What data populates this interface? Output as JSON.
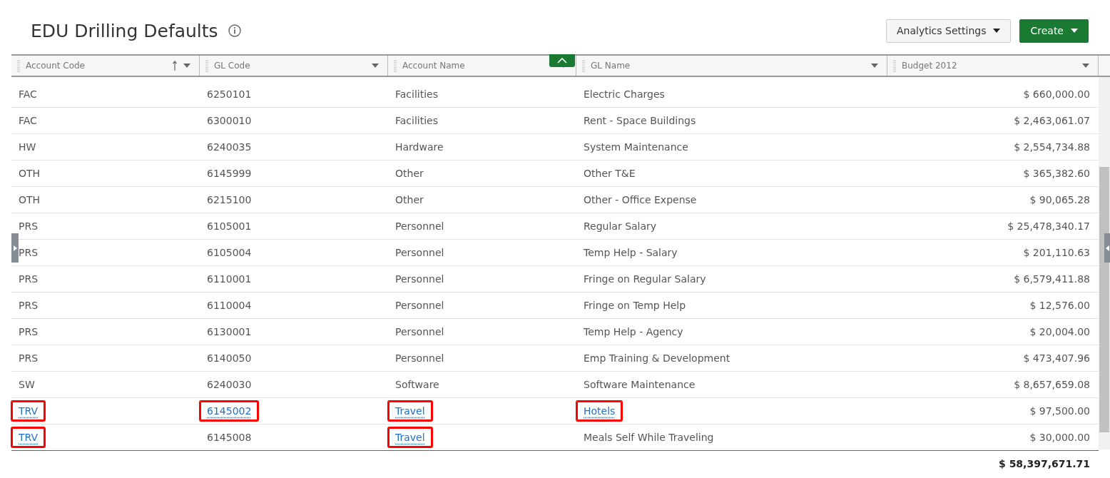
{
  "page": {
    "title": "EDU Drilling Defaults"
  },
  "toolbar": {
    "buttons": [
      {
        "label": "Analytics Settings",
        "kind": "secondary"
      },
      {
        "label": "Create",
        "kind": "primary"
      }
    ]
  },
  "table": {
    "columns": [
      {
        "label": "Account Code",
        "sorted": true,
        "kind": "text"
      },
      {
        "label": "GL Code",
        "sorted": false,
        "kind": "text"
      },
      {
        "label": "Account Name",
        "sorted": false,
        "kind": "text"
      },
      {
        "label": "GL Name",
        "sorted": false,
        "kind": "text"
      },
      {
        "label": "Budget 2012",
        "sorted": false,
        "kind": "amount"
      }
    ],
    "rows": [
      {
        "cells": [
          {
            "text": "FAC"
          },
          {
            "text": "6250101"
          },
          {
            "text": "Facilities"
          },
          {
            "text": "Electric Charges"
          },
          {
            "text": "$ 660,000.00"
          }
        ]
      },
      {
        "cells": [
          {
            "text": "FAC"
          },
          {
            "text": "6300010"
          },
          {
            "text": "Facilities"
          },
          {
            "text": "Rent - Space Buildings"
          },
          {
            "text": "$ 2,463,061.07"
          }
        ]
      },
      {
        "cells": [
          {
            "text": "HW"
          },
          {
            "text": "6240035"
          },
          {
            "text": "Hardware"
          },
          {
            "text": "System Maintenance"
          },
          {
            "text": "$ 2,554,734.88"
          }
        ]
      },
      {
        "cells": [
          {
            "text": "OTH"
          },
          {
            "text": "6145999"
          },
          {
            "text": "Other"
          },
          {
            "text": "Other T&E"
          },
          {
            "text": "$ 365,382.60"
          }
        ]
      },
      {
        "cells": [
          {
            "text": "OTH"
          },
          {
            "text": "6215100"
          },
          {
            "text": "Other"
          },
          {
            "text": "Other - Office Expense"
          },
          {
            "text": "$ 90,065.28"
          }
        ]
      },
      {
        "cells": [
          {
            "text": "PRS"
          },
          {
            "text": "6105001"
          },
          {
            "text": "Personnel"
          },
          {
            "text": "Regular Salary"
          },
          {
            "text": "$ 25,478,340.17"
          }
        ]
      },
      {
        "cells": [
          {
            "text": "PRS"
          },
          {
            "text": "6105004"
          },
          {
            "text": "Personnel"
          },
          {
            "text": "Temp Help - Salary"
          },
          {
            "text": "$ 201,110.63"
          }
        ]
      },
      {
        "cells": [
          {
            "text": "PRS"
          },
          {
            "text": "6110001"
          },
          {
            "text": "Personnel"
          },
          {
            "text": "Fringe on Regular Salary"
          },
          {
            "text": "$ 6,579,411.88"
          }
        ]
      },
      {
        "cells": [
          {
            "text": "PRS"
          },
          {
            "text": "6110004"
          },
          {
            "text": "Personnel"
          },
          {
            "text": "Fringe on Temp Help"
          },
          {
            "text": "$ 12,576.00"
          }
        ]
      },
      {
        "cells": [
          {
            "text": "PRS"
          },
          {
            "text": "6130001"
          },
          {
            "text": "Personnel"
          },
          {
            "text": "Temp Help - Agency"
          },
          {
            "text": "$ 20,004.00"
          }
        ]
      },
      {
        "cells": [
          {
            "text": "PRS"
          },
          {
            "text": "6140050"
          },
          {
            "text": "Personnel"
          },
          {
            "text": "Emp Training & Development"
          },
          {
            "text": "$ 473,407.96"
          }
        ]
      },
      {
        "cells": [
          {
            "text": "SW"
          },
          {
            "text": "6240030"
          },
          {
            "text": "Software"
          },
          {
            "text": "Software Maintenance"
          },
          {
            "text": "$ 8,657,659.08"
          }
        ]
      },
      {
        "cells": [
          {
            "text": "TRV",
            "link": true,
            "highlighted": true
          },
          {
            "text": "6145002",
            "link": true,
            "highlighted": true
          },
          {
            "text": "Travel",
            "link": true,
            "highlighted": true
          },
          {
            "text": "Hotels",
            "link": true,
            "highlighted": true
          },
          {
            "text": "$ 97,500.00"
          }
        ]
      },
      {
        "cells": [
          {
            "text": "TRV",
            "link": true,
            "highlighted": true
          },
          {
            "text": "6145008"
          },
          {
            "text": "Travel",
            "link": true,
            "highlighted": true
          },
          {
            "text": "Meals Self While Traveling"
          },
          {
            "text": "$ 30,000.00"
          }
        ]
      }
    ],
    "total": "$ 58,397,671.71"
  }
}
